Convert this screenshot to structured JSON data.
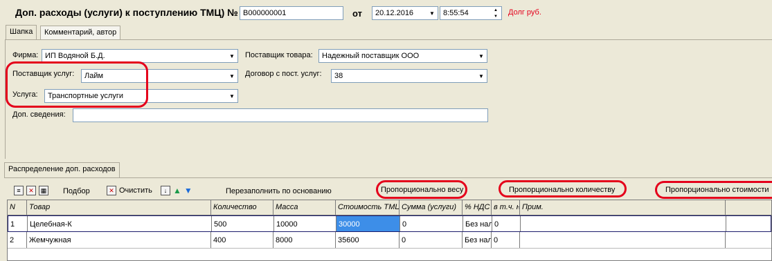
{
  "header": {
    "title": "Доп. расходы (услуги) к поступлению ТМЦ) №",
    "doc_number": "B000000001",
    "from_label": "от",
    "date": "20.12.2016",
    "time": "8:55:54",
    "debt_label": "Долг руб."
  },
  "tabs": [
    {
      "label": "Шапка"
    },
    {
      "label": "Комментарий, автор"
    }
  ],
  "form": {
    "firm_label": "Фирма:",
    "firm_value": "ИП Водяной Б.Д.",
    "supplier_goods_label": "Поставщик товара:",
    "supplier_goods_value": "Надежный поставщик ООО",
    "supplier_services_label": "Поставщик услуг:",
    "supplier_services_value": "Лайм",
    "contract_label": "Договор с пост. услуг:",
    "contract_value": "38",
    "service_label": "Услуга:",
    "service_value": "Транспортные услуги",
    "extra_label": "Доп. сведения:",
    "extra_value": ""
  },
  "bottom_tab": {
    "label": "Распределение доп. расходов"
  },
  "toolbar": {
    "select_label": "Подбор",
    "clear_label": "Очистить",
    "refill_label": "Перезаполнить по основанию",
    "by_weight_label": "Пропорционально весу",
    "by_qty_label": "Пропорционально количеству",
    "by_cost_label": "Пропорционально стоимости"
  },
  "table": {
    "columns": [
      "N",
      "Товар",
      "Количество",
      "Масса",
      "Стоимость ТМЦ",
      "Сумма (услуги)",
      "% НДС",
      "в т.ч. н",
      "Прим."
    ],
    "rows": [
      [
        "1",
        "Целебная-К",
        "500",
        "10000",
        "30000",
        "0",
        "Без нал",
        "0",
        ""
      ],
      [
        "2",
        "Жемчужная",
        "400",
        "8000",
        "35600",
        "0",
        "Без нал",
        "0",
        ""
      ]
    ]
  },
  "colors": {
    "accent_red": "#e4001b",
    "selection": "#3d8ee8"
  }
}
